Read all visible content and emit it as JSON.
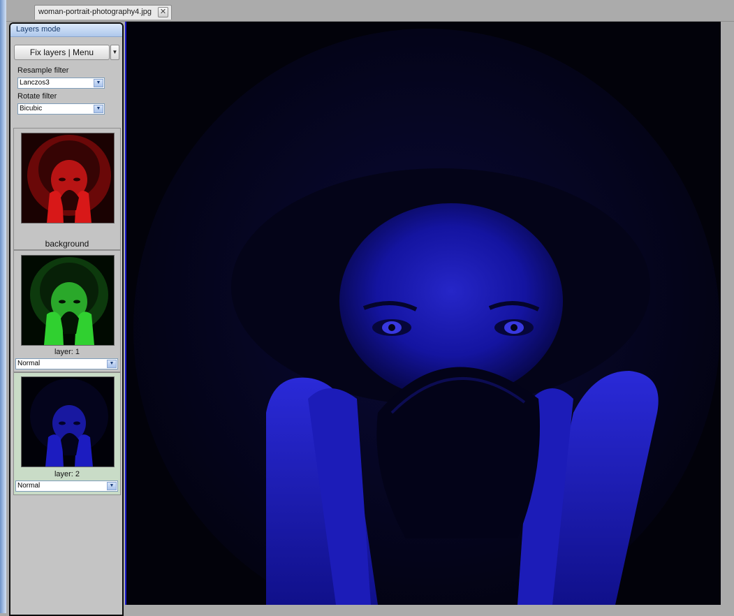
{
  "document_tab": {
    "title": "woman-portrait-photography4.jpg",
    "close_symbol": "✕"
  },
  "panel": {
    "title": "Layers mode",
    "menu_button": "Fix layers | Menu",
    "menu_arrow": "▼",
    "resample_label": "Resample filter",
    "resample_value": "Lanczos3",
    "rotate_label": "Rotate filter",
    "rotate_value": "Bicubic",
    "dropdown_arrow": "▼"
  },
  "layers": [
    {
      "name": "background",
      "tint": "#d41010"
    },
    {
      "name": "layer: 1",
      "blend_mode": "Normal",
      "tint": "#15c815"
    },
    {
      "name": "layer: 2",
      "blend_mode": "Normal",
      "tint": "#1a1ae6",
      "selected": true
    }
  ],
  "colors": {
    "panel_header_text": "#173a6b",
    "selected_layer_bg": "#c9dcc7",
    "canvas_tint": "#1a1ae6"
  },
  "icons": {
    "tab_close": "close-icon",
    "dropdown": "chevron-down-icon"
  }
}
